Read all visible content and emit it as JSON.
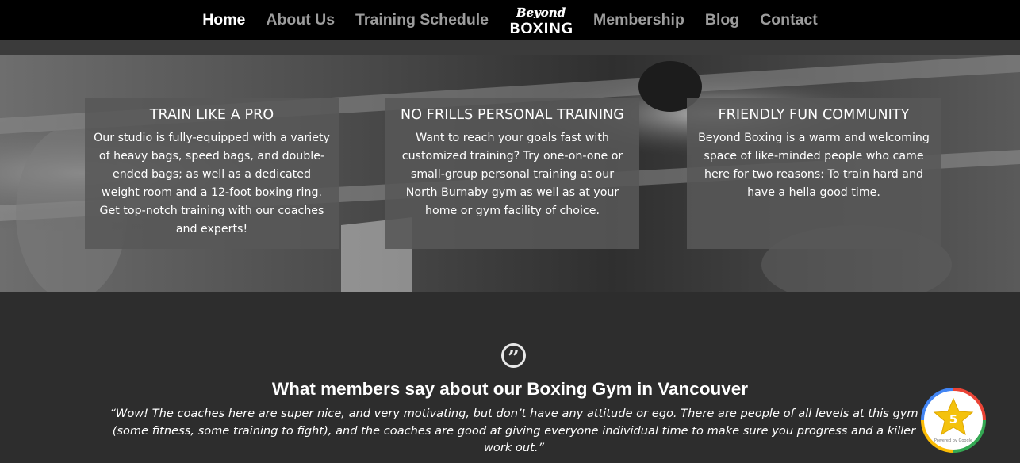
{
  "nav": {
    "items": [
      {
        "label": "Home",
        "active": true
      },
      {
        "label": "About Us"
      },
      {
        "label": "Training Schedule"
      },
      {
        "label": "Membership"
      },
      {
        "label": "Blog"
      },
      {
        "label": "Contact"
      }
    ],
    "logo": {
      "line1": "Beyond",
      "line2": "BOXING"
    }
  },
  "features": [
    {
      "title": "TRAIN LIKE A PRO",
      "text": "Our studio is fully-equipped with a variety of heavy bags, speed bags, and double-ended bags; as well as a dedicated weight room and a 12-foot boxing ring. Get top-notch training with our coaches and experts!"
    },
    {
      "title": "NO FRILLS PERSONAL TRAINING",
      "text": "Want to reach your goals fast with customized training? Try one-on-one or small-group personal training at our North Burnaby gym as well as at your home or gym facility of choice."
    },
    {
      "title": "FRIENDLY FUN COMMUNITY",
      "text": "Beyond Boxing is a warm and welcoming space of like-minded people who came here for two reasons: To train hard and have a hella good time."
    }
  ],
  "testimonials": {
    "heading": "What members say about our Boxing Gym in Vancouver",
    "quote": "“Wow! The coaches here are super nice, and very motivating, but don’t have any attitude or ego. There are people of all levels at this gym (some fitness, some training to fight), and the coaches are good at giving everyone individual time to make sure you progress and a killer work out.”"
  },
  "badge": {
    "rating": "5",
    "caption": "Powered by Google"
  },
  "colors": {
    "nav_bg": "#000000",
    "nav_active": "#ffffff",
    "nav_inactive": "#9c9c9c",
    "page_bg": "#2d2d2d",
    "card_bg": "#585858"
  },
  "icons": [
    "quote-icon",
    "google-rating-star-icon"
  ]
}
